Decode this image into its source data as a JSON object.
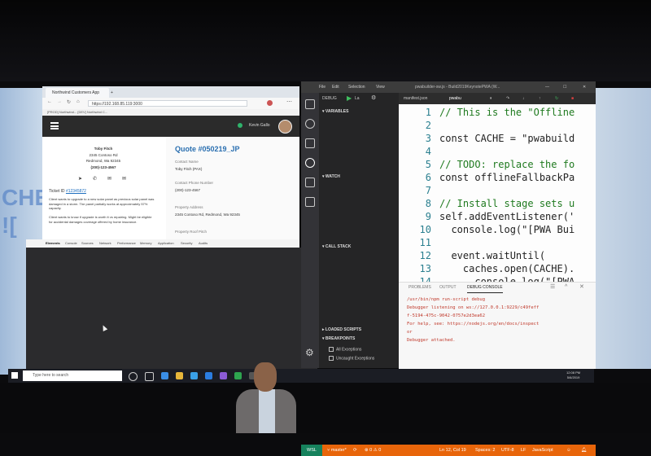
{
  "browser": {
    "tabs": [
      "Northwind Customers App",
      "Northwind..."
    ],
    "address": "https://192.168.85.119:3000",
    "bookmarks": "[PROD] Northwind...   [DEV] Northwind C..."
  },
  "app": {
    "user_name": "Kevin Gallo",
    "customer_name": "Toby Fitch",
    "address_line1": "2345 Contoso Rd",
    "address_line2": "Redmond, Wa 92345",
    "phone": "(200)-123-4567",
    "ticket_label": "Ticket ID",
    "ticket_id": "#12345872",
    "note1": "Client wants to upgrade to a new solar panel as previous solar panel was damaged in a storm. The panel partially works at approximately 57% capacity.",
    "note2": "Client wants to know if upgrade is worth it vs repairing. Might be eligible for accidental damages coverage offered by home insurance.",
    "quote_title": "Quote #050219_JP",
    "contact_name_label": "Contact Name",
    "contact_name": "Toby Fitch (PAX)",
    "contact_phone_label": "Contact Phone Number",
    "contact_phone": "(200)-123-4567",
    "property_address_label": "Property Address",
    "property_address": "2345 Contoso Rd, Redmond, Wa 92345",
    "roof_pitch_label": "Property Roof Pitch"
  },
  "devtools": {
    "tabs": [
      "Elements",
      "Console",
      "Sources",
      "Network",
      "Performance",
      "Memory",
      "Application",
      "Security",
      "Audits"
    ]
  },
  "vscode": {
    "menu": [
      "File",
      "Edit",
      "Selection",
      "View"
    ],
    "window_title": "pwabuilder-sw.js - Build2019KeynotePWA (W...",
    "debug_label": "DEBUG",
    "debug_config": "La",
    "editor_tabs": [
      "manifest.json",
      "pwabu"
    ],
    "sections": {
      "variables": "VARIABLES",
      "watch": "WATCH",
      "call_stack": "CALL STACK",
      "loaded_scripts": "LOADED SCRIPTS",
      "breakpoints": "BREAKPOINTS"
    },
    "breakpoint_items": [
      "All Exceptions",
      "Uncaught Exceptions"
    ],
    "code_lines": [
      {
        "n": "1",
        "text": "// This is the \"Offline"
      },
      {
        "n": "2",
        "text": ""
      },
      {
        "n": "3",
        "text": "const CACHE = \"pwabuild"
      },
      {
        "n": "4",
        "text": ""
      },
      {
        "n": "5",
        "text": "// TODO: replace the fo"
      },
      {
        "n": "6",
        "text": "const offlineFallbackPa"
      },
      {
        "n": "7",
        "text": ""
      },
      {
        "n": "8",
        "text": "// Install stage sets u"
      },
      {
        "n": "9",
        "text": "self.addEventListener('"
      },
      {
        "n": "10",
        "text": "  console.log(\"[PWA Bui"
      },
      {
        "n": "11",
        "text": ""
      },
      {
        "n": "12",
        "text": "  event.waitUntil("
      },
      {
        "n": "13",
        "text": "    caches.open(CACHE)."
      },
      {
        "n": "14",
        "text": "      console.log(\"[PWA"
      }
    ],
    "panel_tabs": [
      "PROBLEMS",
      "OUTPUT",
      "DEBUG CONSOLE"
    ],
    "output_lines": [
      "/usr/bin/npm run-script debug",
      "Debugger listening on ws://127.0.0.1:9229/c49feff",
      "f-5194-475c-9042-0757e2d3ea62",
      "For help, see: https://nodejs.org/en/docs/inspect",
      "or",
      "Debugger attached."
    ],
    "status": {
      "wsl": "WSL",
      "branch": "master*",
      "errors": "0",
      "warnings": "0",
      "position": "Ln 12, Col 19",
      "spaces": "Spaces: 2",
      "encoding": "UTF-8",
      "eol": "LF",
      "language": "JavaScript"
    }
  },
  "taskbar": {
    "search_placeholder": "Type here to search",
    "time": "12:08 PM",
    "date": "5/6/2019"
  },
  "colors": {
    "statusbar": "#e8650a",
    "wsl_badge": "#16825d",
    "quote_title": "#2a6fb0"
  }
}
